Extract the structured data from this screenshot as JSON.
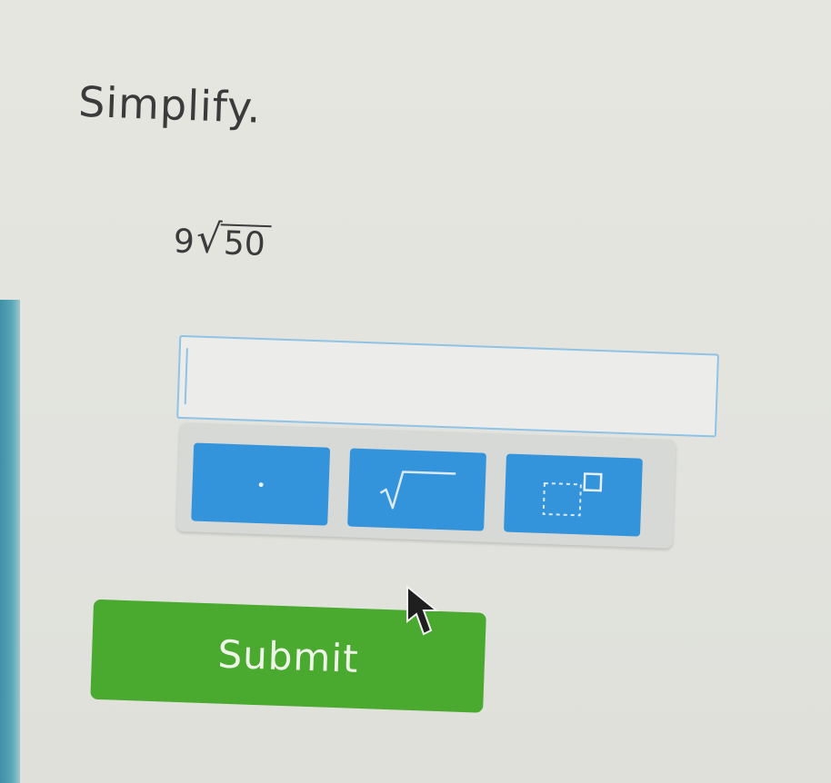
{
  "question": {
    "instruction": "Simplify.",
    "coefficient": "9",
    "radicand": "50"
  },
  "answer": {
    "value": ""
  },
  "keypad": {
    "keys": [
      {
        "name": "decimal",
        "icon": "decimal-point-icon"
      },
      {
        "name": "square-root",
        "icon": "square-root-icon"
      },
      {
        "name": "exponent",
        "icon": "exponent-icon"
      }
    ]
  },
  "submit": {
    "label": "Submit"
  },
  "colors": {
    "key_blue": "#3393db",
    "submit_green": "#4aa92f",
    "focus_border": "#8fc3e6"
  }
}
